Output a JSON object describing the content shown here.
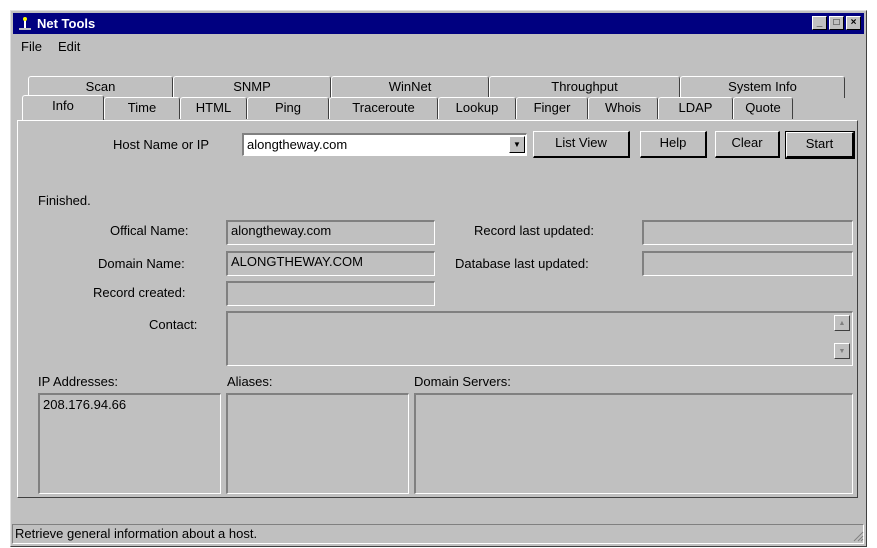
{
  "window": {
    "title": "Net Tools"
  },
  "title_buttons": {
    "minimize": "_",
    "maximize": "□",
    "close": "×"
  },
  "menu": {
    "file": "File",
    "edit": "Edit"
  },
  "tabs_back": [
    "Scan",
    "SNMP",
    "WinNet",
    "Throughput",
    "System Info"
  ],
  "tabs_front": [
    "Info",
    "Time",
    "HTML",
    "Ping",
    "Traceroute",
    "Lookup",
    "Finger",
    "Whois",
    "LDAP",
    "Quote"
  ],
  "active_tab": "Info",
  "host": {
    "label": "Host Name or IP",
    "value": "alongtheway.com",
    "list_view": "List View",
    "help": "Help",
    "clear": "Clear",
    "start": "Start"
  },
  "status_message": "Finished.",
  "fields": {
    "official_name_label": "Offical Name:",
    "official_name": "alongtheway.com",
    "domain_name_label": "Domain Name:",
    "domain_name": "ALONGTHEWAY.COM",
    "record_created_label": "Record created:",
    "record_created": "",
    "record_updated_label": "Record last updated:",
    "record_updated": "",
    "database_updated_label": "Database last updated:",
    "database_updated": "",
    "contact_label": "Contact:",
    "contact": ""
  },
  "lists": {
    "ip_label": "IP Addresses:",
    "ip_values": [
      "208.176.94.66"
    ],
    "aliases_label": "Aliases:",
    "servers_label": "Domain Servers:"
  },
  "statusbar": "Retrieve general information about a host.",
  "colors": {
    "titlebar": "#000080",
    "face": "#c0c0c0"
  },
  "icons": {
    "app": "network-icon",
    "dropdown": "chevron-down-icon",
    "scroll_up": "arrow-up-icon",
    "scroll_down": "arrow-down-icon"
  }
}
